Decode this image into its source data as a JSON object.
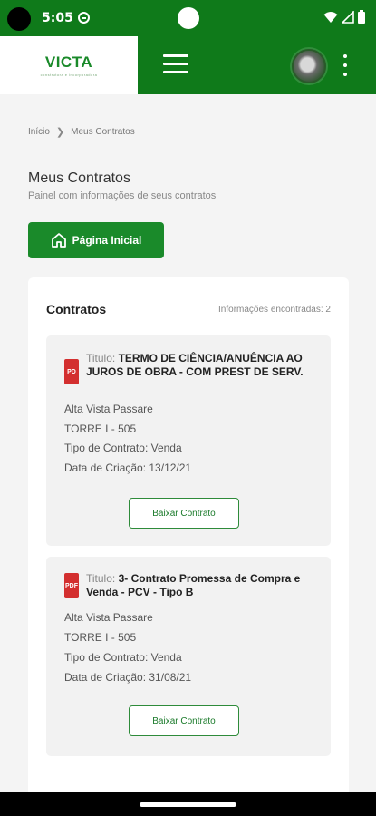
{
  "status_bar": {
    "time": "5:05"
  },
  "app_bar": {
    "logo": "VICTA",
    "logo_tagline": "construtora e incorporadora"
  },
  "breadcrumb": {
    "home": "Início",
    "current": "Meus Contratos"
  },
  "page": {
    "title": "Meus Contratos",
    "subtitle": "Painel com informações de seus contratos",
    "home_button": "Página Inicial"
  },
  "panel": {
    "title": "Contratos",
    "count_text": "Informações encontradas: 2"
  },
  "contracts": [
    {
      "icon_text": "PD",
      "title_label": "Titulo:",
      "title_value": "TERMO DE CIÊNCIA/ANUÊNCIA AO JUROS DE OBRA - COM PREST DE SERV.",
      "project": "Alta Vista Passare",
      "unit": "TORRE I - 505",
      "type": "Tipo de Contrato: Venda",
      "created": "Data de Criação: 13/12/21",
      "button": "Baixar Contrato"
    },
    {
      "icon_text": "PDF",
      "title_label": "Titulo:",
      "title_value": "3- Contrato Promessa de Compra e Venda - PCV - Tipo B",
      "project": "Alta Vista Passare",
      "unit": "TORRE I - 505",
      "type": "Tipo de Contrato: Venda",
      "created": "Data de Criação: 31/08/21",
      "button": "Baixar Contrato"
    }
  ],
  "colors": {
    "brand_green": "#0f7a1a",
    "button_green": "#1a8a2a",
    "pdf_red": "#d32f2f"
  }
}
